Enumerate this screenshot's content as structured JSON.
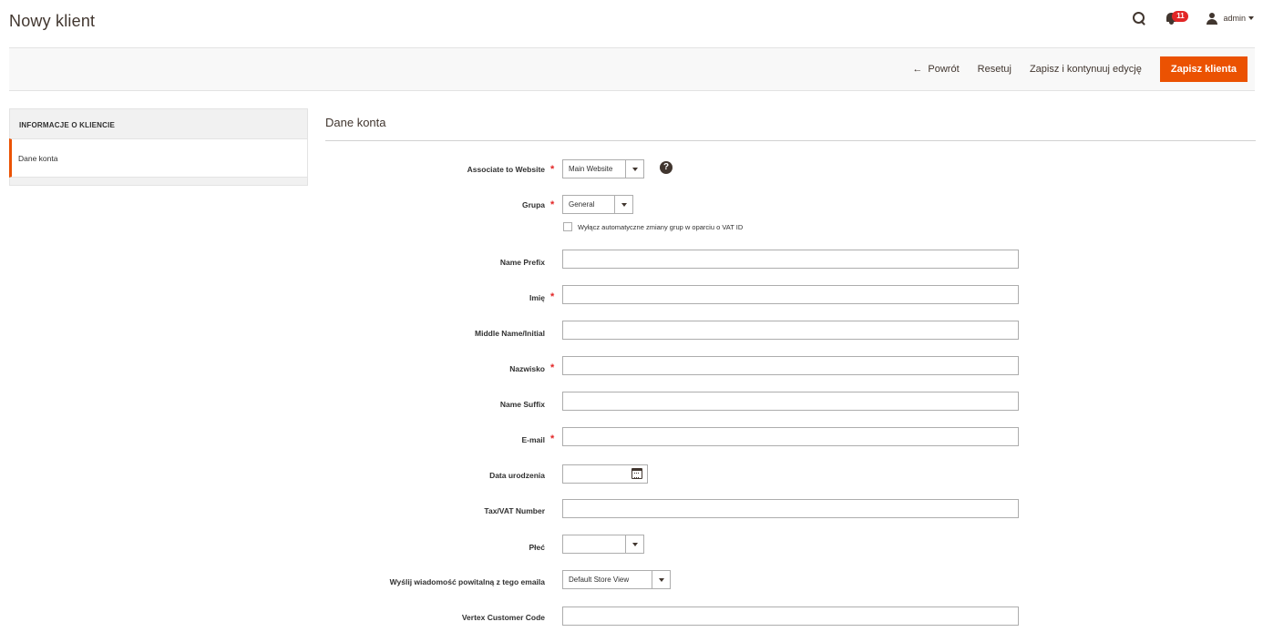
{
  "header": {
    "title": "Nowy klient",
    "notifications_count": "11",
    "user_label": "admin"
  },
  "actions": {
    "back_label": "Powrót",
    "reset_label": "Resetuj",
    "save_continue_label": "Zapisz i kontynuuj edycję",
    "save_label": "Zapisz klienta"
  },
  "sidebar": {
    "title": "INFORMACJE O KLIENCIE",
    "items": [
      {
        "label": "Dane konta",
        "active": true
      }
    ]
  },
  "form": {
    "section_title": "Dane konta",
    "website": {
      "label": "Associate to Website",
      "value": "Main Website",
      "required": true
    },
    "group": {
      "label": "Grupa",
      "value": "General",
      "required": true
    },
    "disable_auto_group": {
      "label": "Wyłącz automatyczne zmiany grup w oparciu o VAT ID",
      "checked": false
    },
    "name_prefix": {
      "label": "Name Prefix",
      "value": ""
    },
    "first_name": {
      "label": "Imię",
      "value": "",
      "required": true
    },
    "middle_name": {
      "label": "Middle Name/Initial",
      "value": ""
    },
    "last_name": {
      "label": "Nazwisko",
      "value": "",
      "required": true
    },
    "name_suffix": {
      "label": "Name Suffix",
      "value": ""
    },
    "email": {
      "label": "E-mail",
      "value": "",
      "required": true
    },
    "dob": {
      "label": "Data urodzenia",
      "value": ""
    },
    "taxvat": {
      "label": "Tax/VAT Number",
      "value": ""
    },
    "gender": {
      "label": "Płeć",
      "value": ""
    },
    "sendemail_store": {
      "label": "Wyślij wiadomość powitalną z tego emaila",
      "value": "Default Store View"
    },
    "vertex_code": {
      "label": "Vertex Customer Code",
      "value": ""
    }
  },
  "colors": {
    "accent": "#eb5202",
    "required": "#e22626",
    "text": "#303030"
  },
  "icons": {
    "search": "search-icon",
    "notifications": "bell-icon",
    "user": "user-icon",
    "help": "help-icon",
    "calendar": "calendar-icon"
  }
}
